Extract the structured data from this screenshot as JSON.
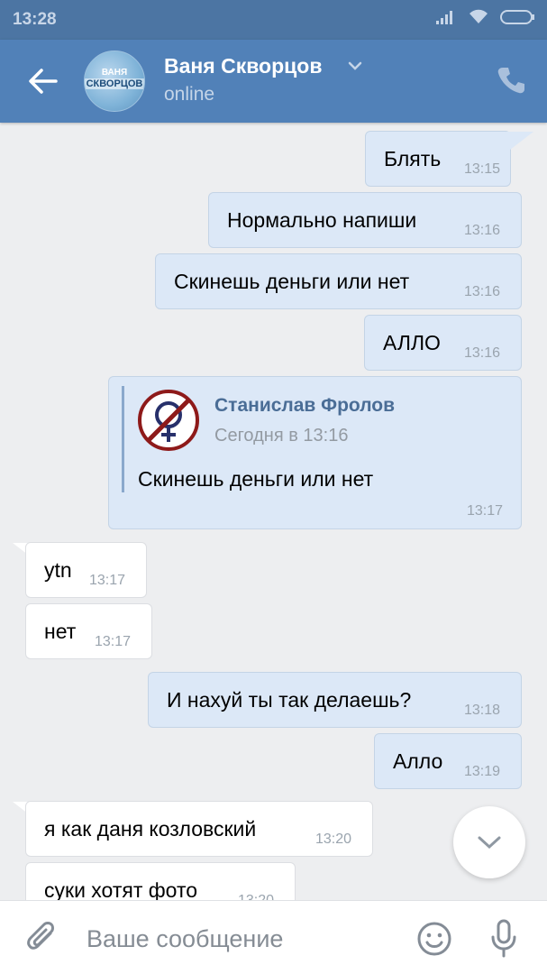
{
  "statusbar": {
    "time": "13:28"
  },
  "header": {
    "contact_name": "Ваня Скворцов",
    "status": "online",
    "avatar_top": "ВАНЯ",
    "avatar_bottom": "СКВОРЦОВ"
  },
  "messages": [
    {
      "dir": "out",
      "text": "Блять",
      "time": "13:15"
    },
    {
      "dir": "out",
      "text": "Нормально напиши",
      "time": "13:16"
    },
    {
      "dir": "out",
      "text": "Скинешь деньги или нет",
      "time": "13:16"
    },
    {
      "dir": "out",
      "text": "АЛЛО",
      "time": "13:16"
    },
    {
      "dir": "out",
      "forwarded": {
        "author": "Станислав Фролов",
        "date": "Сегодня в 13:16",
        "text": "Скинешь деньги или нет"
      },
      "time": "13:17"
    },
    {
      "dir": "in",
      "text": "ytn",
      "time": "13:17"
    },
    {
      "dir": "in",
      "text": "нет",
      "time": "13:17"
    },
    {
      "dir": "out",
      "text": "И нахуй ты так делаешь?",
      "time": "13:18"
    },
    {
      "dir": "out",
      "text": "Алло",
      "time": "13:19"
    },
    {
      "dir": "in",
      "text": "я как даня козловский",
      "time": "13:20"
    },
    {
      "dir": "in",
      "text": "суки хотят фото",
      "time": "13:20"
    }
  ],
  "composer": {
    "placeholder": "Ваше сообщение"
  },
  "icons": {
    "back": "arrow-left-icon",
    "phone": "phone-icon",
    "scroll_down": "chevron-down-icon",
    "attach": "paperclip-icon",
    "emoji": "smile-icon",
    "mic": "microphone-icon"
  },
  "colors": {
    "header": "#5181b8",
    "statusbar": "#4c75a3",
    "outgoing_bubble": "#dce8f7",
    "incoming_bubble": "#ffffff",
    "background": "#edeef0",
    "forward_author": "#4a6d96"
  }
}
